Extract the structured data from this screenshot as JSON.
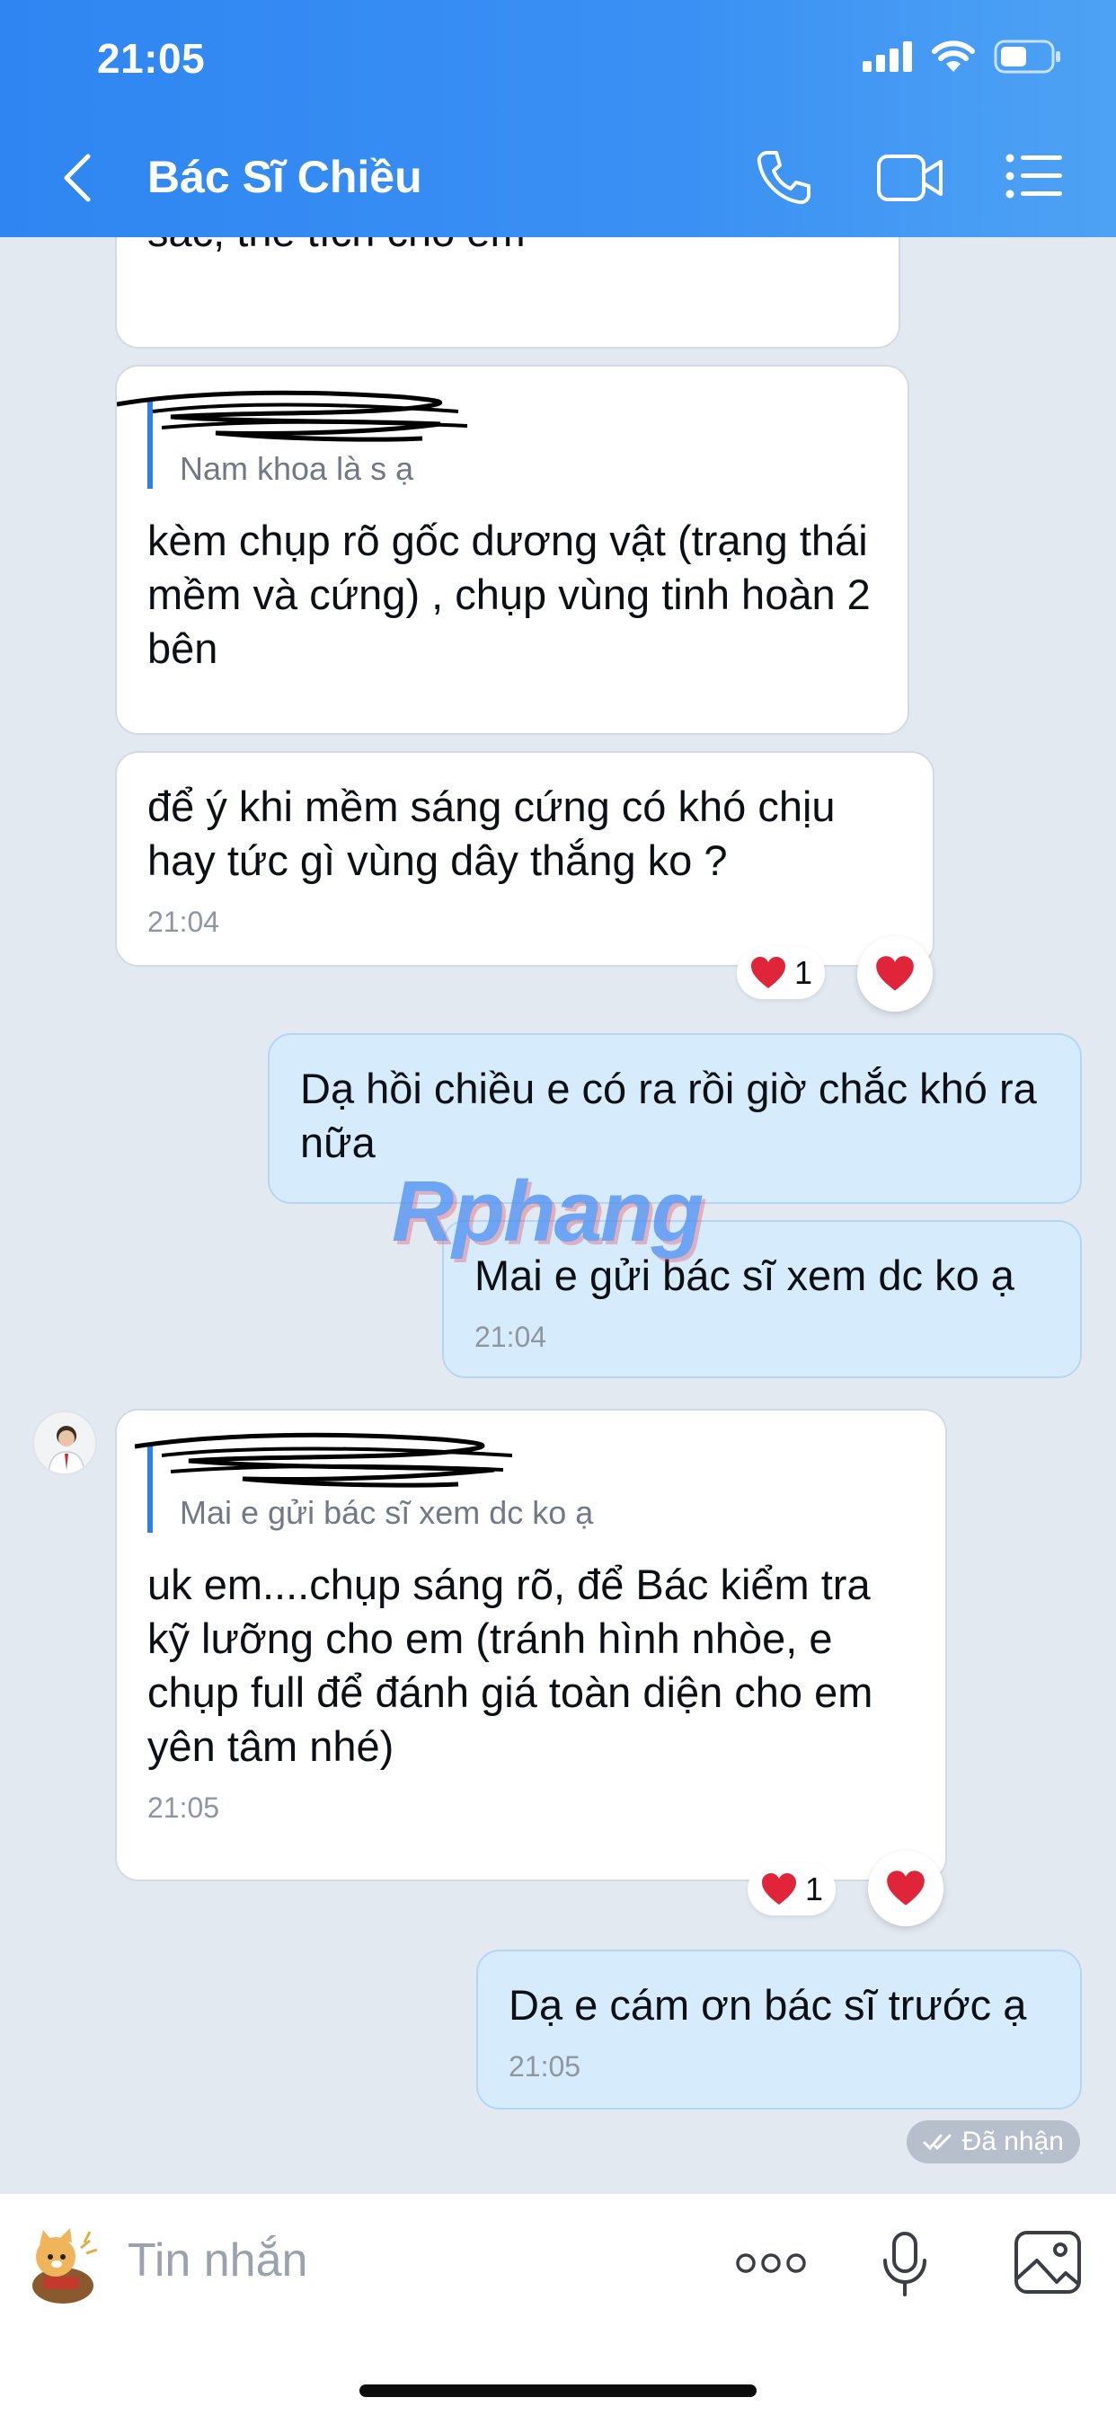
{
  "status_bar": {
    "time": "21:05"
  },
  "header": {
    "title": "Bác Sĩ Chiều"
  },
  "messages": [
    {
      "text": "lòng bàn tay để Bác đánh giá màu sắc, thể tích cho em"
    },
    {
      "quote_text": "Nam khoa là s ạ",
      "text": "kèm chụp rõ gốc dương vật (trạng thái mềm và cứng) , chụp vùng tinh hoàn 2 bên"
    },
    {
      "text": "để ý khi mềm sáng cứng có khó chịu hay tức gì vùng dây thắng ko ?",
      "time": "21:04",
      "reaction_count": "1"
    },
    {
      "text": "Dạ hồi chiều e có ra rồi giờ chắc khó ra nữa"
    },
    {
      "text": "Mai e gửi bác sĩ xem dc ko ạ",
      "time": "21:04"
    },
    {
      "quote_text": "Mai e gửi bác sĩ xem dc ko ạ",
      "text": "uk em....chụp sáng rõ, để Bác kiểm tra kỹ lưỡng cho em (tránh hình nhòe, e chụp full để đánh giá toàn diện cho em yên tâm nhé)",
      "time": "21:05",
      "reaction_count": "1"
    },
    {
      "text": "Dạ e cám ơn bác sĩ trước ạ",
      "time": "21:05"
    }
  ],
  "delivered_label": "Đã nhận",
  "watermark": "Rphang",
  "input": {
    "placeholder": "Tin nhắn"
  },
  "colors": {
    "header": "#3a90f3",
    "outgoing": "#d6ecfd",
    "incoming": "#ffffff",
    "background": "#e3e9f1",
    "heart": "#e0243a"
  },
  "icons": [
    "back-icon",
    "phone-icon",
    "video-icon",
    "menu-list-icon",
    "heart-icon",
    "sticker-icon",
    "more-icon",
    "mic-icon",
    "image-icon",
    "double-check-icon"
  ]
}
